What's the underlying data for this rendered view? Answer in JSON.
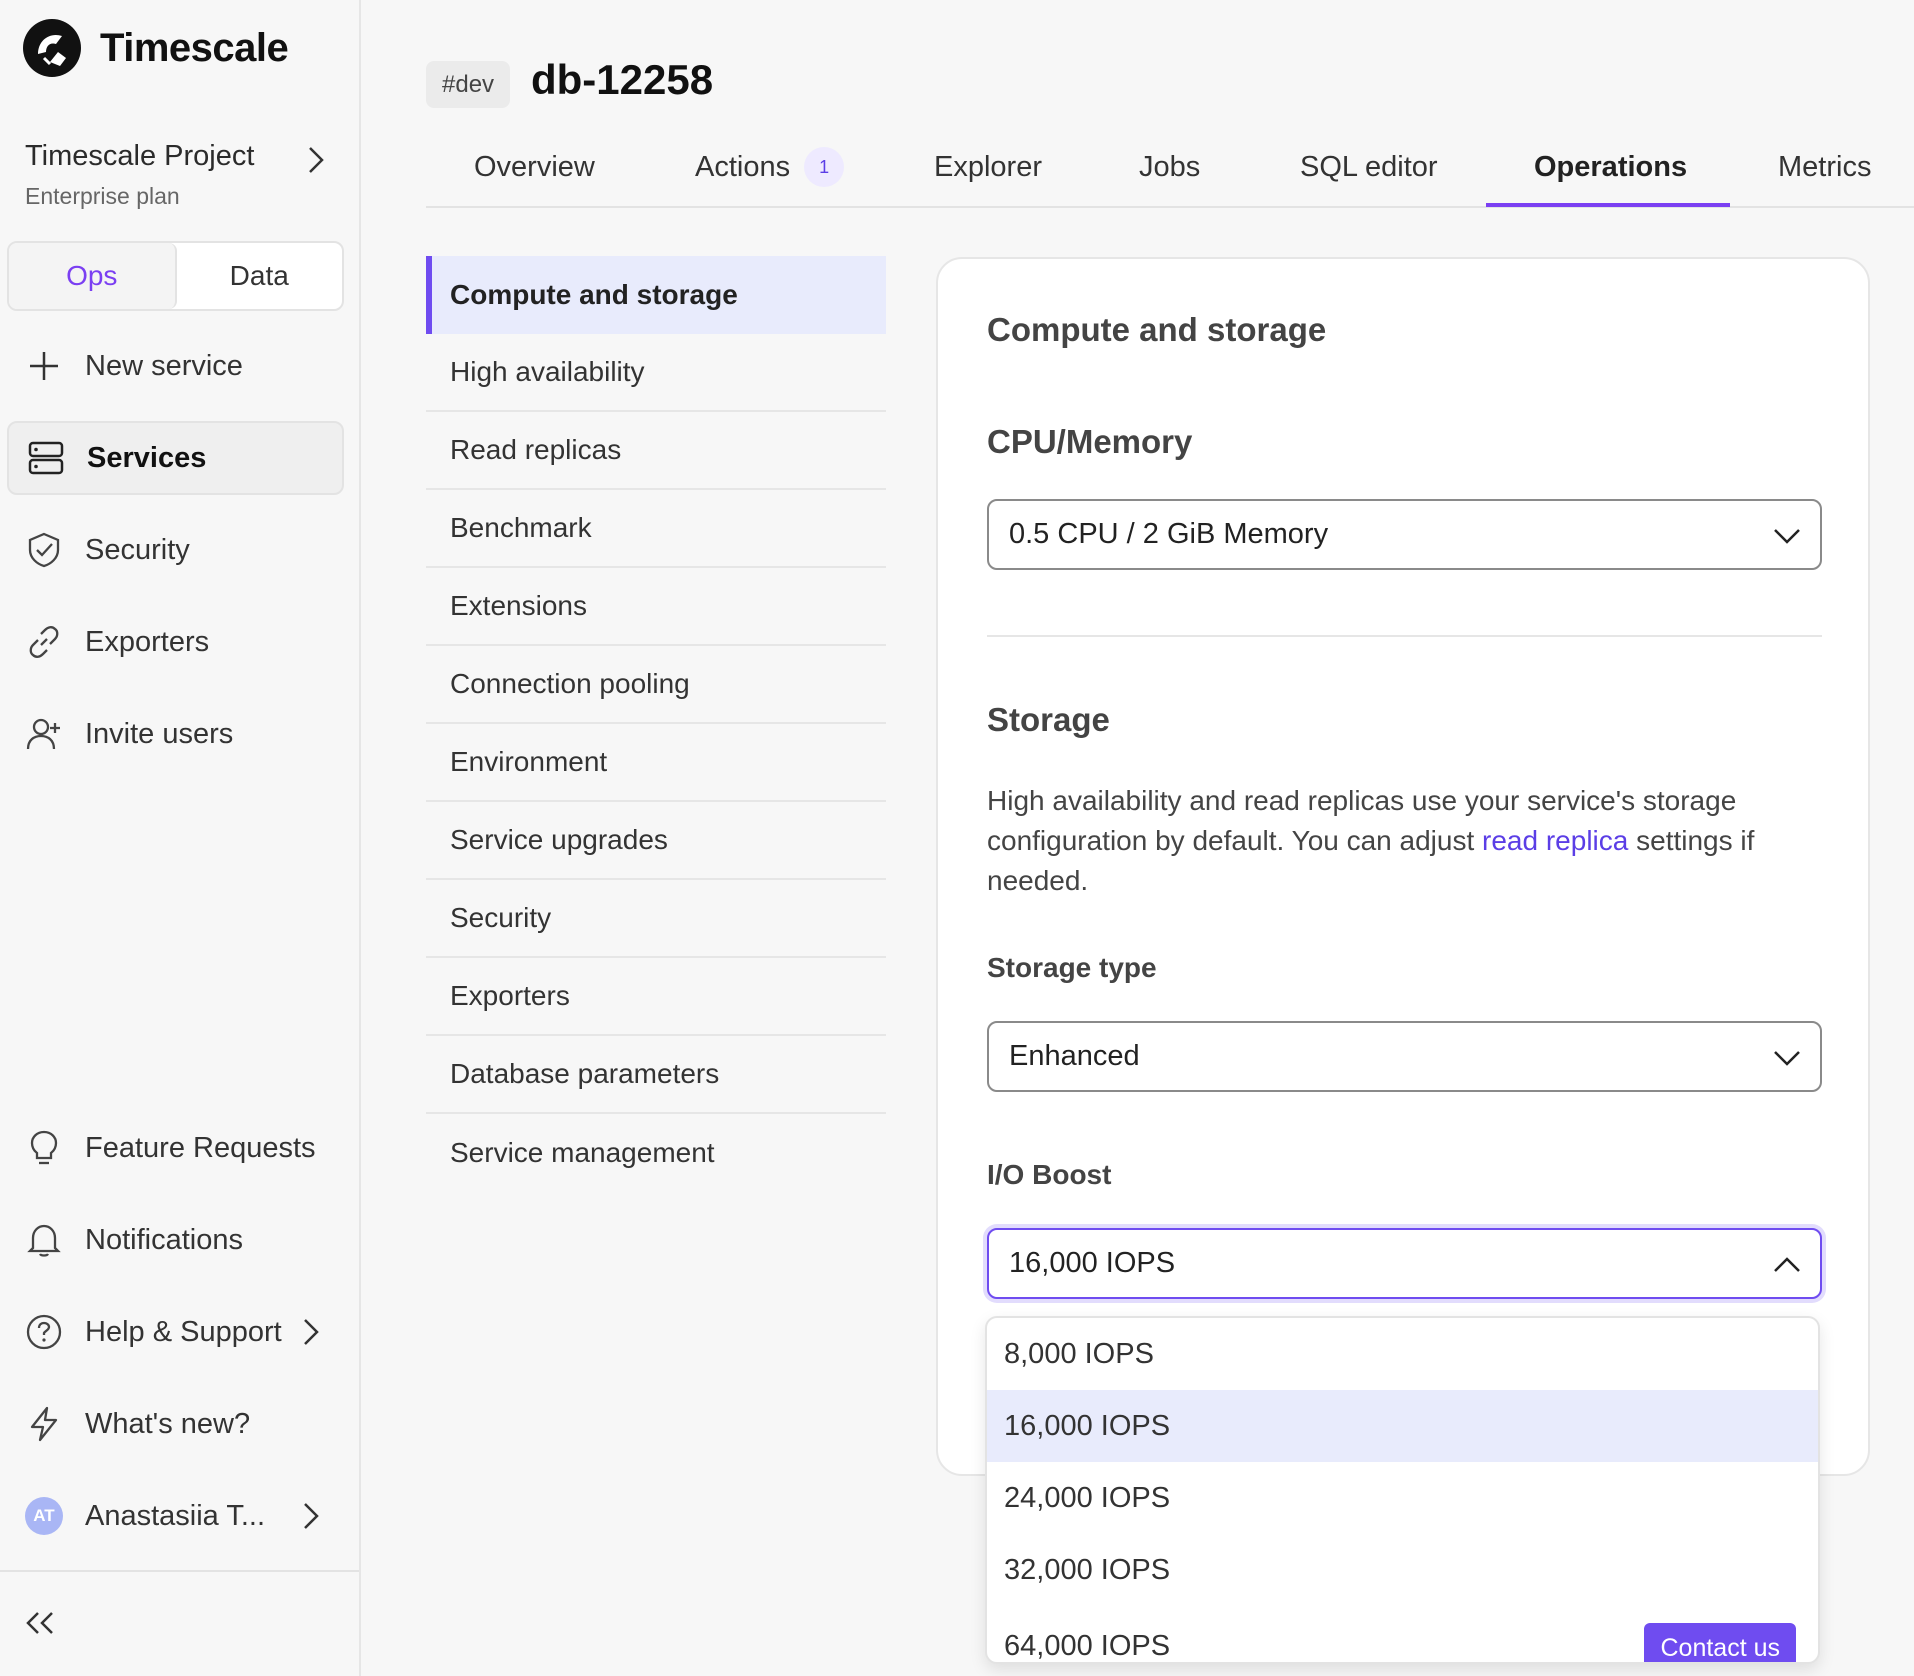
{
  "brand": {
    "name": "Timescale"
  },
  "project": {
    "name": "Timescale Project",
    "plan": "Enterprise plan"
  },
  "mode_switch": {
    "ops": "Ops",
    "data": "Data",
    "active": "Ops"
  },
  "sidebar": {
    "top_items": [
      {
        "label": "New service",
        "icon": "plus-icon"
      },
      {
        "label": "Services",
        "icon": "server-icon",
        "active": true
      },
      {
        "label": "Security",
        "icon": "shield-check-icon"
      },
      {
        "label": "Exporters",
        "icon": "link-icon"
      },
      {
        "label": "Invite users",
        "icon": "user-plus-icon"
      }
    ],
    "bottom_items": [
      {
        "label": "Feature Requests",
        "icon": "lightbulb-icon"
      },
      {
        "label": "Notifications",
        "icon": "bell-icon"
      },
      {
        "label": "Help & Support",
        "icon": "question-circle-icon"
      },
      {
        "label": "What's new?",
        "icon": "lightning-icon"
      }
    ],
    "user": {
      "initials": "AT",
      "name": "Anastasiia T..."
    }
  },
  "service": {
    "env": "#dev",
    "name": "db-12258"
  },
  "tabs": [
    {
      "label": "Overview"
    },
    {
      "label": "Actions",
      "count": "1"
    },
    {
      "label": "Explorer"
    },
    {
      "label": "Jobs"
    },
    {
      "label": "SQL editor"
    },
    {
      "label": "Operations",
      "active": true
    },
    {
      "label": "Metrics"
    }
  ],
  "submenu": [
    "Compute and storage",
    "High availability",
    "Read replicas",
    "Benchmark",
    "Extensions",
    "Connection pooling",
    "Environment",
    "Service upgrades",
    "Security",
    "Exporters",
    "Database parameters",
    "Service management"
  ],
  "card": {
    "title": "Compute and storage",
    "cpu_section": "CPU/Memory",
    "cpu_value": "0.5 CPU / 2 GiB Memory",
    "storage_section": "Storage",
    "storage_desc_before": "High availability and read replicas use your service's storage configuration by default. You can adjust ",
    "storage_desc_link": "read replica",
    "storage_desc_after": " settings if needed.",
    "storage_type_label": "Storage type",
    "storage_type_value": "Enhanced",
    "io_boost_label": "I/O Boost",
    "io_boost_value": "16,000 IOPS"
  },
  "io_options": [
    "8,000 IOPS",
    "16,000 IOPS",
    "24,000 IOPS",
    "32,000 IOPS",
    "64,000 IOPS"
  ],
  "io_selected": "16,000 IOPS",
  "contact_label": "Contact us",
  "colors": {
    "accent": "#6f4cf0",
    "selected_bg": "#e8ebfc"
  }
}
